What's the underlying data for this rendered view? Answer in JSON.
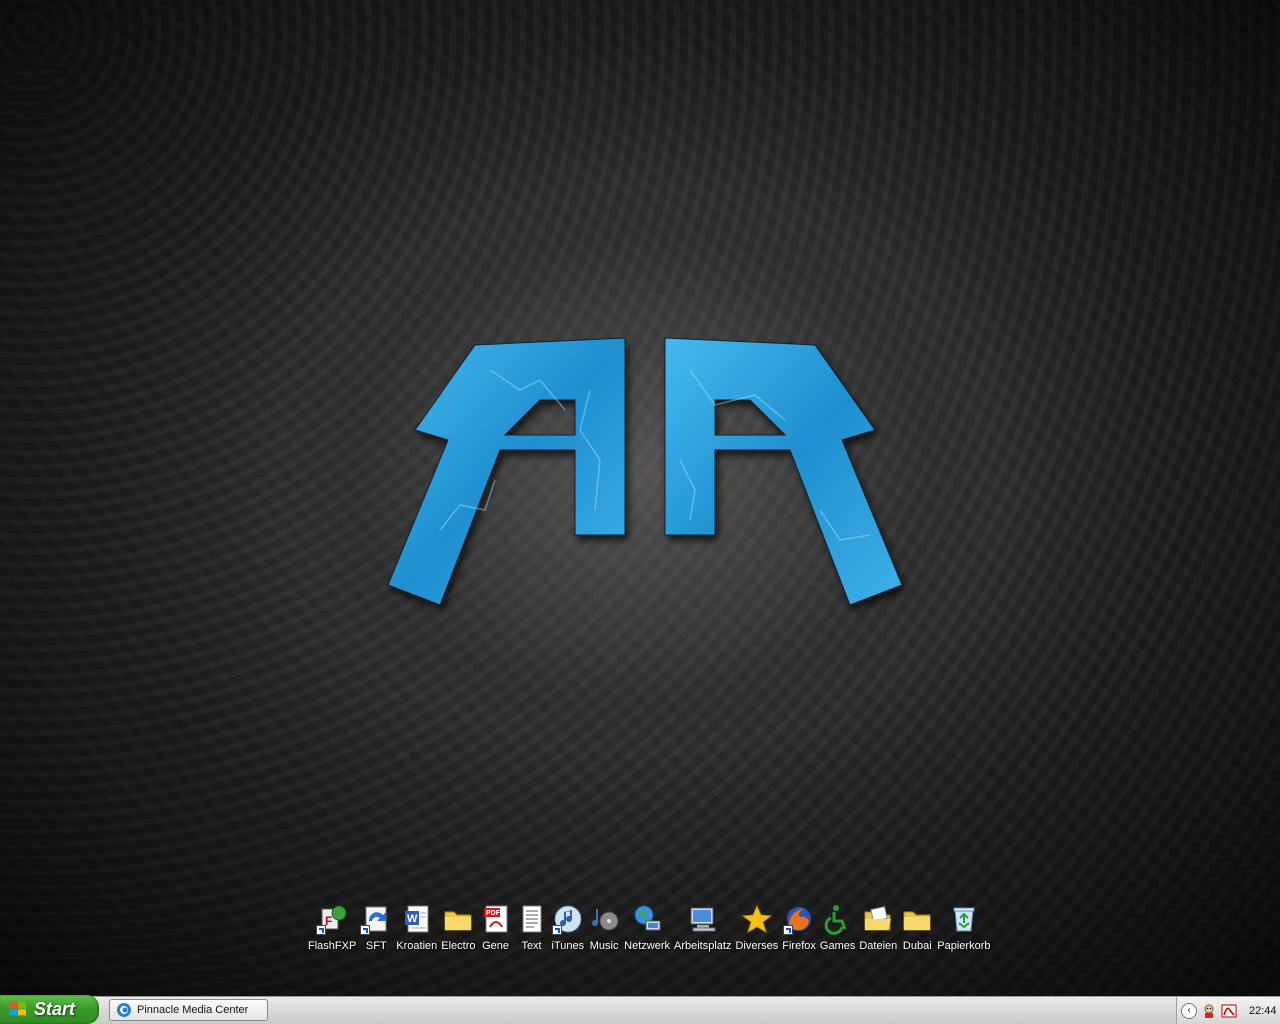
{
  "desktop": {
    "wallpaper_colors": {
      "background": "#262626",
      "logo_blue": "#2fa6e0",
      "logo_light": "#7fd6ff"
    },
    "icons": [
      {
        "label": "FlashFXP",
        "icon": "flashfxp-icon",
        "shortcut": true
      },
      {
        "label": "SFT",
        "icon": "sync-arrows-icon",
        "shortcut": true
      },
      {
        "label": "Kroatien",
        "icon": "word-document-icon",
        "shortcut": false
      },
      {
        "label": "Electro",
        "icon": "folder-icon",
        "shortcut": false
      },
      {
        "label": "Gene",
        "icon": "pdf-document-icon",
        "shortcut": false
      },
      {
        "label": "Text",
        "icon": "text-document-icon",
        "shortcut": false
      },
      {
        "label": "iTunes",
        "icon": "itunes-icon",
        "shortcut": true
      },
      {
        "label": "Music",
        "icon": "music-folder-icon",
        "shortcut": false
      },
      {
        "label": "Netzwerk",
        "icon": "network-globe-icon",
        "shortcut": false
      },
      {
        "label": "Arbeitsplatz",
        "icon": "my-computer-icon",
        "shortcut": false
      },
      {
        "label": "Diverses",
        "icon": "star-icon",
        "shortcut": false
      },
      {
        "label": "Firefox",
        "icon": "firefox-icon",
        "shortcut": true
      },
      {
        "label": "Games",
        "icon": "accessibility-icon",
        "shortcut": false
      },
      {
        "label": "Dateien",
        "icon": "open-folder-icon",
        "shortcut": false
      },
      {
        "label": "Dubai",
        "icon": "folder-icon",
        "shortcut": false
      },
      {
        "label": "Papierkorb",
        "icon": "recycle-bin-icon",
        "shortcut": false
      }
    ]
  },
  "taskbar": {
    "start_label": "Start",
    "tasks": [
      {
        "label": "Pinnacle Media Center",
        "icon": "pinnacle-icon"
      }
    ],
    "tray": {
      "icons": [
        "tray-expand-icon",
        "messenger-icon",
        "acrobat-icon"
      ],
      "clock": "22:44"
    }
  }
}
